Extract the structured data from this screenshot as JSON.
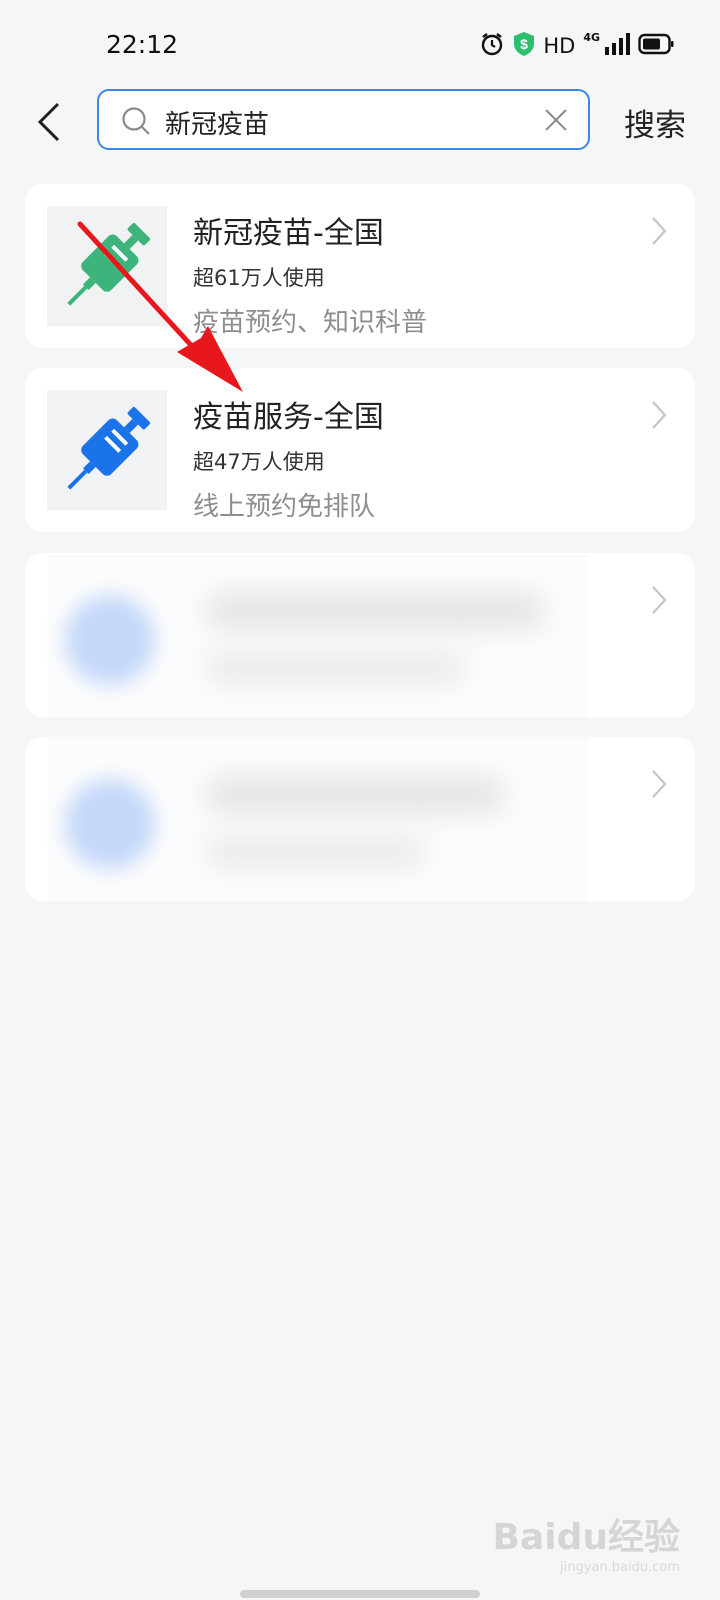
{
  "status_bar": {
    "time": "22:12",
    "hd_label": "HD",
    "network_label": "4G"
  },
  "search": {
    "query": "新冠疫苗",
    "button_label": "搜索"
  },
  "results": [
    {
      "title": "新冠疫苗-全国",
      "users": "超61万人使用",
      "desc": "疫苗预约、知识科普",
      "icon": "syringe-icon",
      "icon_color": "#3cb47c"
    },
    {
      "title": "疫苗服务-全国",
      "users": "超47万人使用",
      "desc": "线上预约免排队",
      "icon": "syringe-icon",
      "icon_color": "#1a73e8"
    }
  ],
  "colors": {
    "search_border": "#3b86e8",
    "annotation_arrow": "#e8171e",
    "blurred_icon": "#a8c8f8"
  },
  "watermark": {
    "logo": "Baidu经验",
    "sub": "jingyan.baidu.com"
  }
}
